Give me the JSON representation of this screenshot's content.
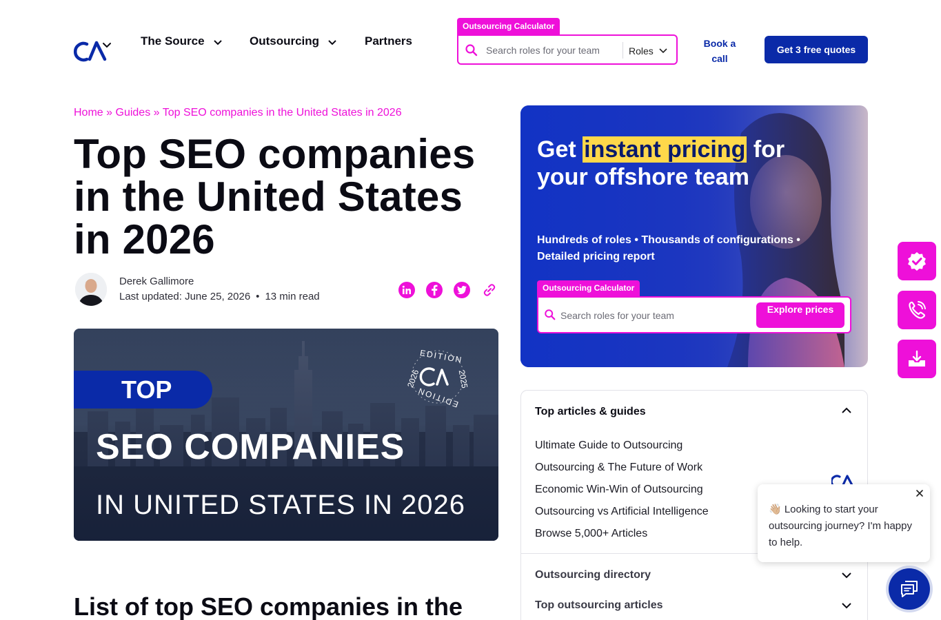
{
  "header": {
    "nav": [
      {
        "label": "The Source",
        "has_dropdown": true
      },
      {
        "label": "Outsourcing",
        "has_dropdown": true
      },
      {
        "label": "Partners",
        "has_dropdown": false
      }
    ],
    "calculator": {
      "tab_label": "Outsourcing Calculator",
      "placeholder": "Search roles for your team",
      "roles_label": "Roles"
    },
    "book_call": "Book a call",
    "quotes_button": "Get 3 free quotes"
  },
  "breadcrumb": {
    "home": "Home",
    "sep": "»",
    "guides": "Guides",
    "current": "Top SEO companies in the United States in 2026"
  },
  "article": {
    "title": "Top SEO companies in the United States in 2026",
    "author": "Derek Gallimore",
    "updated": "Last updated: June 25, 2026",
    "dot": "•",
    "read_time": "13 min read",
    "share_icons": [
      "linkedin-icon",
      "facebook-icon",
      "twitter-icon",
      "link-icon"
    ],
    "hero": {
      "top": "TOP",
      "heading": "SEO COMPANIES",
      "subheading": "IN UNITED STATES IN 2026",
      "badge_text": "2026 EDITION 2025 EDITION"
    },
    "section_heading": "List of top SEO companies in the"
  },
  "promo": {
    "heading_pre": "Get ",
    "heading_highlight": "instant pricing",
    "heading_post": "for your offshore team",
    "subtext": "Hundreds of roles • Thousands of configurations • Detailed pricing report",
    "calc_tab": "Outsourcing Calculator",
    "placeholder": "Search roles for your team",
    "button": "Explore prices"
  },
  "panel": {
    "heading": "Top articles & guides",
    "items": [
      "Ultimate Guide to Outsourcing",
      "Outsourcing & The Future of Work",
      "Economic Win-Win of Outsourcing",
      "Outsourcing vs Artificial Intelligence",
      "Browse 5,000+ Articles"
    ],
    "directory": "Outsourcing directory",
    "top_articles": "Top outsourcing articles"
  },
  "chat": {
    "message": "👋🏼 Looking to start your outsourcing journey? I'm happy to help."
  },
  "colors": {
    "brand_blue": "#0a2aa8",
    "accent_magenta": "#ee10d9",
    "highlight_yellow": "#ffd84a"
  }
}
